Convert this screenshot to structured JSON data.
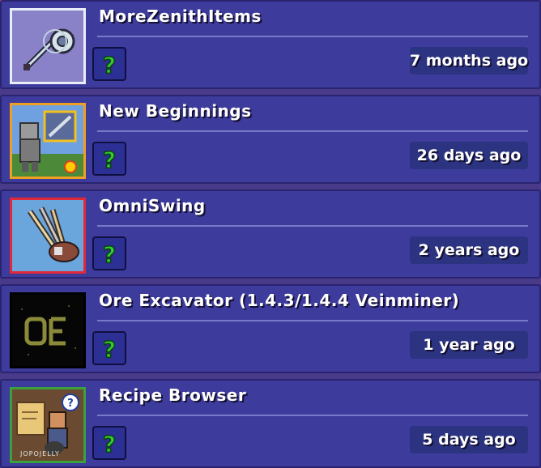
{
  "mods": [
    {
      "name": "MoreZenithItems",
      "updated": "7 months ago",
      "icon": "zenith-sword-and-disc-icon",
      "frame_color": "#e8eef8",
      "bg_color": "#8a82c8"
    },
    {
      "name": "New Beginnings",
      "updated": "26 days ago",
      "icon": "armored-character-icon",
      "frame_color": "#f0a020",
      "bg_color": "#6fa0e0"
    },
    {
      "name": "OmniSwing",
      "updated": "2 years ago",
      "icon": "swords-icon",
      "frame_color": "#e02838",
      "bg_color": "#6aa6dc"
    },
    {
      "name": "Ore Excavator (1.4.3/1.4.4 Veinminer)",
      "updated": "1 year ago",
      "icon": "oe-logo-icon",
      "frame_color": "#000000",
      "bg_color": "#0a0a0a"
    },
    {
      "name": "Recipe Browser",
      "updated": "5 days ago",
      "icon": "recipe-guide-icon",
      "frame_color": "#3ca03c",
      "bg_color": "#7a5a3c",
      "watermark": "JOPOJELLY"
    }
  ],
  "help_button": {
    "icon": "question-mark-icon",
    "color": "#33cc33"
  }
}
